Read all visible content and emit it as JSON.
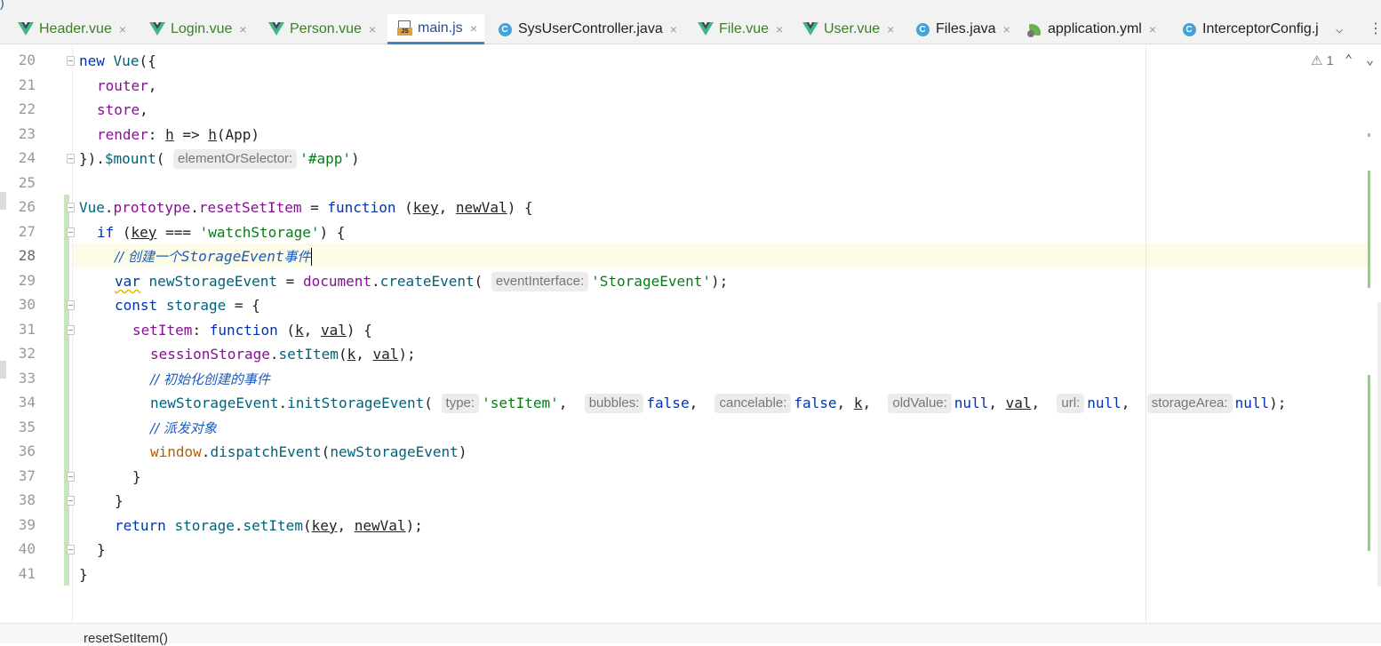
{
  "tabs": [
    {
      "label": "Header.vue",
      "type": "vue",
      "active": false
    },
    {
      "label": "Login.vue",
      "type": "vue",
      "active": false
    },
    {
      "label": "Person.vue",
      "type": "vue",
      "active": false
    },
    {
      "label": "main.js",
      "type": "js",
      "active": true
    },
    {
      "label": "SysUserController.java",
      "type": "java",
      "active": false
    },
    {
      "label": "File.vue",
      "type": "vue",
      "active": false
    },
    {
      "label": "User.vue",
      "type": "vue",
      "active": false
    },
    {
      "label": "Files.java",
      "type": "java",
      "active": false
    },
    {
      "label": "application.yml",
      "type": "yml",
      "active": false
    },
    {
      "label": "InterceptorConfig.j",
      "type": "java",
      "active": false
    }
  ],
  "icons": {
    "tab_close": "×",
    "dropdown": "⌵",
    "tab_scroll_right": "⋮",
    "warning": "⚠",
    "up": "⌃",
    "down": "⌄",
    "java_letter": "C",
    "js_letter": "JS"
  },
  "colors": {
    "keyword": "#0033b3",
    "function": "#00627a",
    "property": "#871094",
    "string": "#067d17",
    "comment": "#1e5bb8",
    "vue_green": "#41b883",
    "active_tab_underline": "#4083c9"
  },
  "editor": {
    "line_numbers": [
      "20",
      "21",
      "22",
      "23",
      "24",
      "25",
      "26",
      "27",
      "28",
      "29",
      "30",
      "31",
      "32",
      "33",
      "34",
      "35",
      "36",
      "37",
      "38",
      "39",
      "40",
      "41"
    ],
    "warning_count": "1",
    "code": {
      "l20": {
        "a": "new",
        "b": "Vue",
        "c": "({"
      },
      "l21": {
        "a": "router",
        "b": ","
      },
      "l22": {
        "a": "store",
        "b": ","
      },
      "l23": {
        "a": "render",
        "b": ": ",
        "c": "h",
        "d": " => ",
        "e": "h",
        "f": "(App)"
      },
      "l24": {
        "a": "}).",
        "b": "$mount",
        "c": "(",
        "hint": "elementOrSelector:",
        "d": "'#app'",
        "e": ")"
      },
      "l26": {
        "a": "Vue",
        "b": ".",
        "c": "prototype",
        "d": ".",
        "e": "resetSetItem",
        "f": " = ",
        "g": "function",
        "h": " (",
        "i": "key",
        "j": ", ",
        "k": "newVal",
        "l": ") {"
      },
      "l27": {
        "a": "if",
        "b": " (",
        "c": "key",
        "d": " === ",
        "e": "'watchStorage'",
        "f": ") {"
      },
      "l28": {
        "a": "// 创建一个",
        "b": "StorageEvent",
        "c": "事件"
      },
      "l29": {
        "a": "var",
        "b": " ",
        "c": "newStorageEvent",
        "d": " = ",
        "e": "document",
        "f": ".",
        "g": "createEvent",
        "h": "(",
        "hint": "eventInterface:",
        "i": "'StorageEvent'",
        "j": ");"
      },
      "l30": {
        "a": "const",
        "b": " ",
        "c": "storage",
        "d": " = {"
      },
      "l31": {
        "a": "setItem",
        "b": ": ",
        "c": "function",
        "d": " (",
        "e": "k",
        "f": ", ",
        "g": "val",
        "h": ") {"
      },
      "l32": {
        "a": "sessionStorage",
        "b": ".",
        "c": "setItem",
        "d": "(",
        "e": "k",
        "f": ", ",
        "g": "val",
        "h": ");"
      },
      "l33": {
        "a": "// 初始化创建的事件"
      },
      "l34": {
        "a": "newStorageEvent",
        "b": ".",
        "c": "initStorageEvent",
        "d": "(",
        "h1": "type:",
        "e": "'setItem'",
        "f": ", ",
        "h2": "bubbles:",
        "g": "false",
        "h": ", ",
        "h3": "cancelable:",
        "i": "false",
        "j": ", ",
        "k": "k",
        "l": ", ",
        "h4": "oldValue:",
        "m": "null",
        "n": ", ",
        "o": "val",
        "p": ", ",
        "h5": "url:",
        "q": "null",
        "r": ", ",
        "h6": "storageArea:",
        "s": "null",
        "t": ");"
      },
      "l35": {
        "a": "// 派发对象"
      },
      "l36": {
        "a": "window",
        "b": ".",
        "c": "dispatchEvent",
        "d": "(",
        "e": "newStorageEvent",
        "f": ")"
      },
      "l37": {
        "a": "}"
      },
      "l38": {
        "a": "}"
      },
      "l39": {
        "a": "return",
        "b": " ",
        "c": "storage",
        "d": ".",
        "e": "setItem",
        "f": "(",
        "g": "key",
        "h": ", ",
        "i": "newVal",
        "j": ");"
      },
      "l40": {
        "a": "}"
      },
      "l41": {
        "a": "}"
      }
    }
  },
  "statusbar": {
    "breadcrumb": "resetSetItem()"
  }
}
